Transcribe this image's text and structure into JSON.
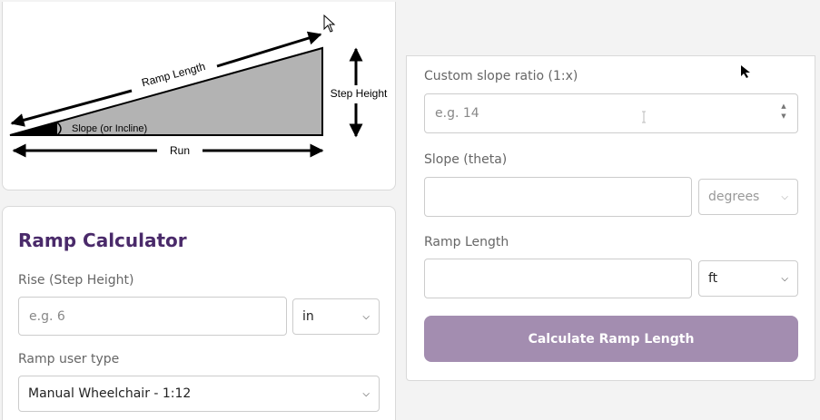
{
  "diagram": {
    "ramp_length_label": "Ramp Length",
    "step_height_label": "Step Height",
    "slope_label": "Slope (or Incline)",
    "run_label": "Run"
  },
  "calculator": {
    "title": "Ramp Calculator",
    "rise_label": "Rise (Step Height)",
    "rise_placeholder": "e.g. 6",
    "rise_unit": "in",
    "user_type_label": "Ramp user type",
    "user_type_value": "Manual Wheelchair - 1:12"
  },
  "right_panel": {
    "custom_slope_label": "Custom slope ratio (1:x)",
    "custom_slope_placeholder": "e.g. 14",
    "slope_theta_label": "Slope (theta)",
    "slope_theta_value": "",
    "slope_unit": "degrees",
    "ramp_length_label": "Ramp Length",
    "ramp_length_value": "",
    "length_unit": "ft",
    "calculate_button": "Calculate Ramp Length"
  },
  "colors": {
    "title": "#4a2a6a",
    "button_bg": "#a38db0",
    "ramp_fill": "#b3b3b3"
  }
}
